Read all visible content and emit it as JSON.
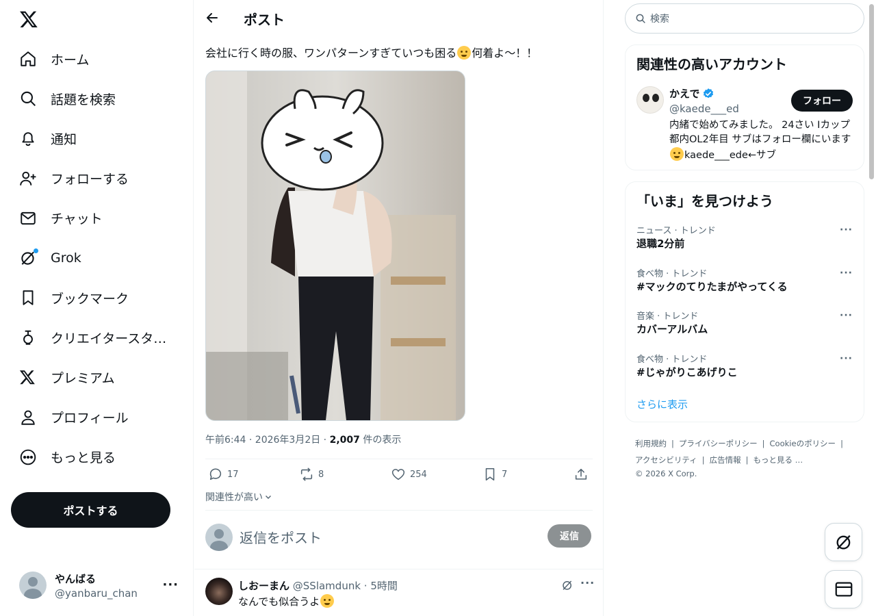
{
  "nav": {
    "items": [
      {
        "label": "ホーム",
        "icon": "home-icon"
      },
      {
        "label": "話題を検索",
        "icon": "search-icon"
      },
      {
        "label": "通知",
        "icon": "bell-icon"
      },
      {
        "label": "フォローする",
        "icon": "follow-icon"
      },
      {
        "label": "チャット",
        "icon": "mail-icon"
      },
      {
        "label": "Grok",
        "icon": "grok-icon"
      },
      {
        "label": "ブックマーク",
        "icon": "bookmark-icon"
      },
      {
        "label": "クリエイタースタ…",
        "icon": "creator-icon"
      },
      {
        "label": "プレミアム",
        "icon": "x-logo-icon"
      },
      {
        "label": "プロフィール",
        "icon": "profile-icon"
      },
      {
        "label": "もっと見る",
        "icon": "more-circle-icon"
      }
    ],
    "post_button": "ポストする"
  },
  "account": {
    "name": "やんばる",
    "handle": "@yanbaru_chan",
    "more": "···"
  },
  "main": {
    "header_title": "ポスト",
    "tweet_text_before": "会社に行く時の服、ワンパターンすぎていつも困る",
    "tweet_text_after": "何着よ〜！！",
    "meta_time": "午前6:44 · 2026年3月2日 · ",
    "meta_views": "2,007",
    "meta_views_suffix": " 件の表示",
    "actions": {
      "replies": "17",
      "reposts": "8",
      "likes": "254",
      "bookmarks": "7"
    },
    "relevance": "関連性が高い",
    "reply_placeholder": "返信をポスト",
    "reply_button": "返信",
    "reply": {
      "name": "しおーまん",
      "meta": " @SSlamdunk · 5時間",
      "body": "なんでも似合うよ"
    }
  },
  "right": {
    "search_placeholder": "検索",
    "accounts_title": "関連性の高いアカウント",
    "account": {
      "name": "かえで",
      "handle": "@kaede___ed",
      "bio_before": "内緒で始めてみました。 24さい Iカップ 都内OL2年目 サブはフォロー欄にいます",
      "bio_after": "kaede___ede←サブ",
      "follow": "フォロー"
    },
    "trends_title": "「いま」を見つけよう",
    "trends": [
      {
        "category": "ニュース · トレンド",
        "name": "退職2分前"
      },
      {
        "category": "食べ物 · トレンド",
        "name": "#マックのてりたまがやってくる"
      },
      {
        "category": "音楽 · トレンド",
        "name": "カバーアルバム"
      },
      {
        "category": "食べ物 · トレンド",
        "name": "#じゃがりこあげりこ"
      }
    ],
    "show_more": "さらに表示",
    "footer": {
      "terms": "利用規約",
      "privacy": "プライバシーポリシー",
      "cookie": "Cookieのポリシー",
      "accessibility": "アクセシビリティ",
      "ads": "広告情報",
      "more": "もっと見る …",
      "copyright": "© 2026 X Corp."
    }
  },
  "colors": {
    "accent": "#1d9bf0",
    "text": "#0f1419",
    "muted": "#536471",
    "border": "#eff3f4",
    "verified": "#1d9bf0"
  }
}
